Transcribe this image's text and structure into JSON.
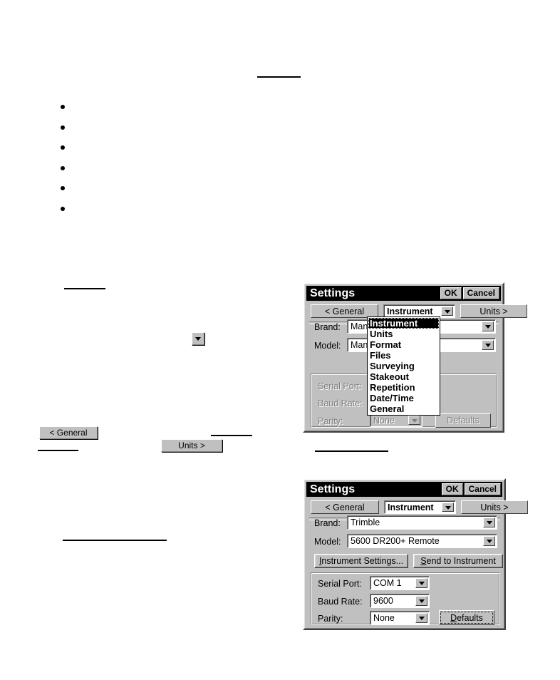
{
  "page": {
    "background": "#ffffff",
    "bullets_count": 6
  },
  "inline_widgets": {
    "dropdown_arrow_icon": "chevron-down-icon",
    "general_button": "< General",
    "units_button": "Units >"
  },
  "dialog_one": {
    "title": "Settings",
    "ok_label": "OK",
    "cancel_label": "Cancel",
    "prev_label": "< General",
    "next_label": "Units >",
    "page_selector_value": "Instrument",
    "brand_label": "Brand:",
    "brand_value": "Manual",
    "model_label": "Model:",
    "model_value": "Manual",
    "serial_port_label": "Serial Port:",
    "baud_rate_label": "Baud Rate:",
    "parity_label": "Parity:",
    "parity_value": "None",
    "defaults_label": "Defaults",
    "dropdown_open": true,
    "dropdown_items": [
      "Instrument",
      "Units",
      "Format",
      "Files",
      "Surveying",
      "Stakeout",
      "Repetition",
      "Date/Time",
      "General"
    ],
    "dropdown_selected_index": 0
  },
  "dialog_two": {
    "title": "Settings",
    "ok_label": "OK",
    "cancel_label": "Cancel",
    "prev_label": "< General",
    "next_label": "Units >",
    "page_selector_value": "Instrument",
    "brand_label": "Brand:",
    "brand_value": "Trimble",
    "model_label": "Model:",
    "model_value": "5600 DR200+ Remote",
    "instrument_settings_label": "Instrument Settings...",
    "send_to_instrument_label": "Send to Instrument",
    "serial_port_label": "Serial Port:",
    "serial_port_value": "COM 1",
    "baud_rate_label": "Baud Rate:",
    "baud_rate_value": "9600",
    "parity_label": "Parity:",
    "parity_value": "None",
    "defaults_label": "Defaults"
  },
  "colors": {
    "face": "#c0c0c0",
    "titlebar": "#000000",
    "title_text": "#ffffff",
    "text": "#000000",
    "disabled_text": "#808080",
    "field_bg": "#ffffff"
  }
}
